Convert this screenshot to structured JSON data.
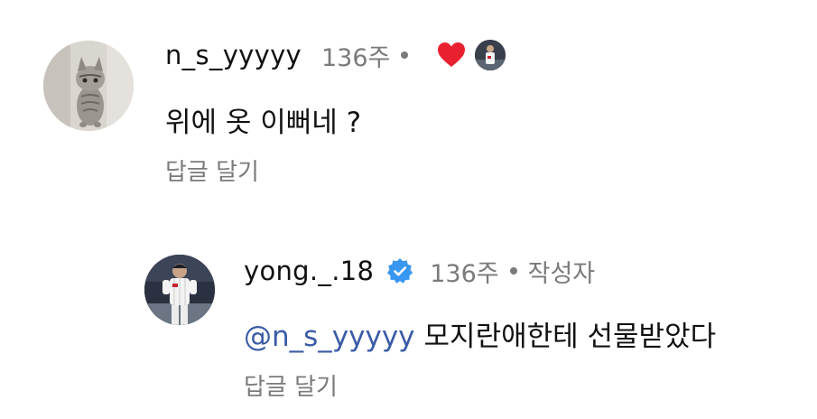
{
  "comments": [
    {
      "username": "n_s_yyyyy",
      "time": "136주",
      "text": "위에 옷 이뻐네 ?",
      "reply_label": "답글 달기",
      "icons": {
        "avatar": "kitten-avatar",
        "liked": "heart-icon",
        "liked_by": "author-mini-avatar"
      },
      "colors": {
        "heart": "#e8202f"
      }
    },
    {
      "username": "yong._.18",
      "time": "136주",
      "author_label": "작성자",
      "mention": "@n_s_yyyyy",
      "text": "모지란애한테 선물받았다",
      "reply_label": "답글 달기",
      "icons": {
        "avatar": "baseball-player-avatar",
        "verified": "verified-badge-icon"
      },
      "colors": {
        "mention": "#3a5ba6",
        "verified": "#3897f0"
      }
    }
  ]
}
